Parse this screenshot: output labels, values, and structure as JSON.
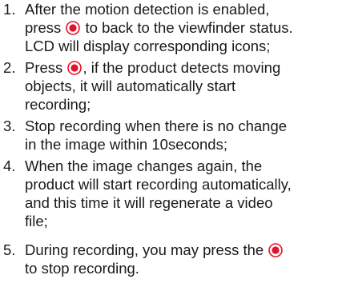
{
  "steps": [
    {
      "number": "1.",
      "line1_before": "After the motion detection is enabled,",
      "line2_before": "press",
      "line2_after": "to back to the viewfinder status.",
      "line3": "LCD will display corresponding icons;"
    },
    {
      "number": "2.",
      "line1_before": "Press",
      "line1_after": ", if the product detects moving",
      "line2": "objects, it will automatically start",
      "line3": "recording;"
    },
    {
      "number": "3.",
      "line1": "Stop recording when there is no change",
      "line2": "in the image within 10seconds;"
    },
    {
      "number": "4.",
      "line1": "When the image changes again, the",
      "line2": "product will start recording automatically,",
      "line3": "and this time it will regenerate a video",
      "line4": "file;"
    },
    {
      "number": "5.",
      "line1_before": "During recording, you may press the",
      "line2": "to stop recording."
    }
  ],
  "icons": {
    "record_button": "record-button-icon"
  },
  "colors": {
    "icon_red": "#e3122b",
    "text": "#1a1a1a"
  }
}
